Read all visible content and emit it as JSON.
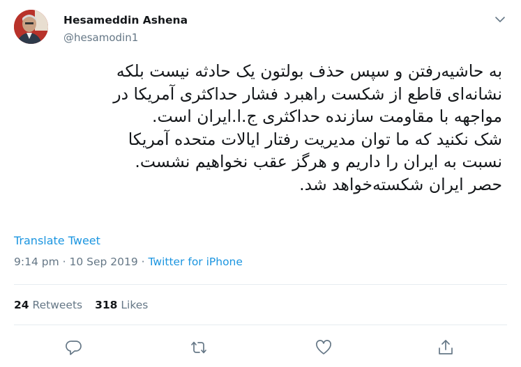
{
  "author": {
    "name": "Hesameddin Ashena",
    "handle": "@hesamodin1"
  },
  "tweet_lines": [
    "به حاشیه‌رفتن و سپس حذف بولتون یک حادثه نیست بلکه",
    "نشانه‌ای قاطع از  شکست راهبرد فشار حداکثری آمریکا در",
    "مواجهه با مقاومت سازنده حداکثری ج.ا.ایران است.",
    "شک نکنید که ما توان مدیریت رفتار ایالات متحده آمریکا",
    "نسبت به ایران را داریم و هرگز عقب نخواهیم نشست.",
    "حصر ایران شکسته‌خواهد شد."
  ],
  "translate_label": "Translate Tweet",
  "meta": {
    "time": "9:14 pm",
    "sep1": " · ",
    "date": "10 Sep 2019",
    "sep2": " · ",
    "source": "Twitter for iPhone"
  },
  "stats": {
    "retweets_count": "24",
    "retweets_label": "Retweets",
    "likes_count": "318",
    "likes_label": "Likes"
  },
  "icons": {
    "reply": "reply-icon",
    "retweet": "retweet-icon",
    "like": "heart-icon",
    "share": "share-icon",
    "menu": "chevron-down-icon"
  },
  "colors": {
    "link": "#1b95e0",
    "muted": "#657786",
    "text": "#14171a",
    "divider": "#e6ecf0"
  }
}
